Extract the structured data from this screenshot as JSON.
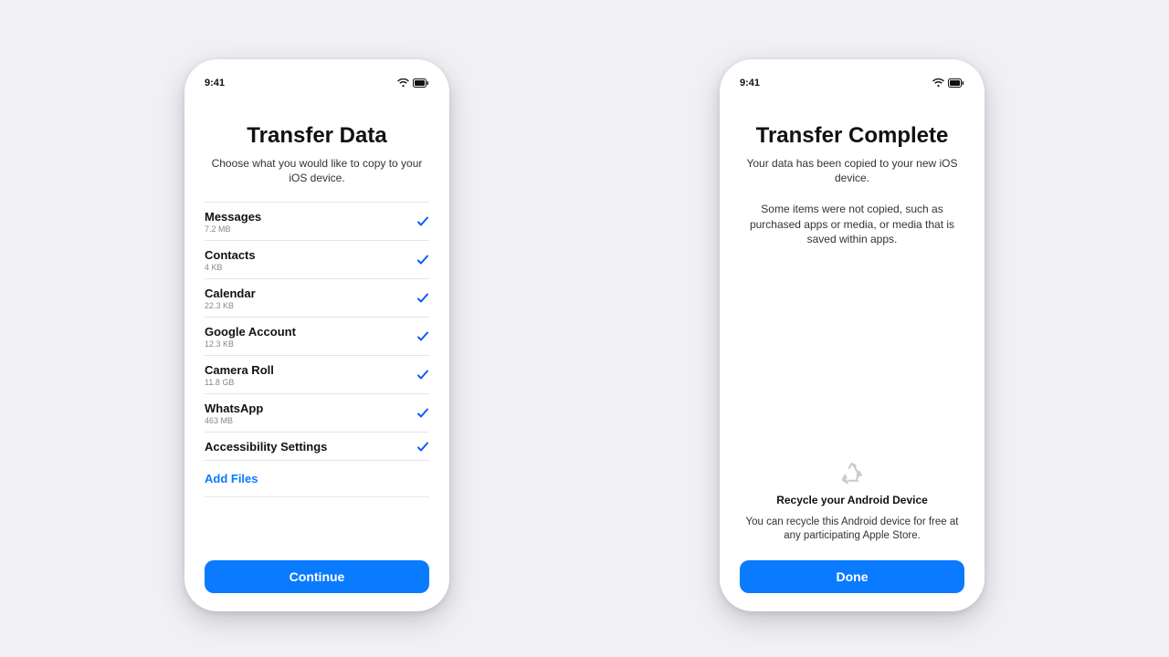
{
  "status": {
    "time": "9:41"
  },
  "left": {
    "title": "Transfer Data",
    "subtitle": "Choose what you would like to copy to your iOS device.",
    "items": [
      {
        "label": "Messages",
        "size": "7.2 MB"
      },
      {
        "label": "Contacts",
        "size": "4 KB"
      },
      {
        "label": "Calendar",
        "size": "22.3 KB"
      },
      {
        "label": "Google Account",
        "size": "12.3 KB"
      },
      {
        "label": "Camera Roll",
        "size": "11.8 GB"
      },
      {
        "label": "WhatsApp",
        "size": "463 MB"
      },
      {
        "label": "Accessibility Settings",
        "size": ""
      }
    ],
    "add_files": "Add Files",
    "continue": "Continue"
  },
  "right": {
    "title": "Transfer Complete",
    "subtitle": "Your data has been copied to your new iOS device.",
    "note": "Some items were not copied, such as purchased apps or media, or media that is saved within apps.",
    "recycle_title": "Recycle your Android Device",
    "recycle_sub": "You can recycle this Android device for free at any participating Apple Store.",
    "done": "Done"
  }
}
